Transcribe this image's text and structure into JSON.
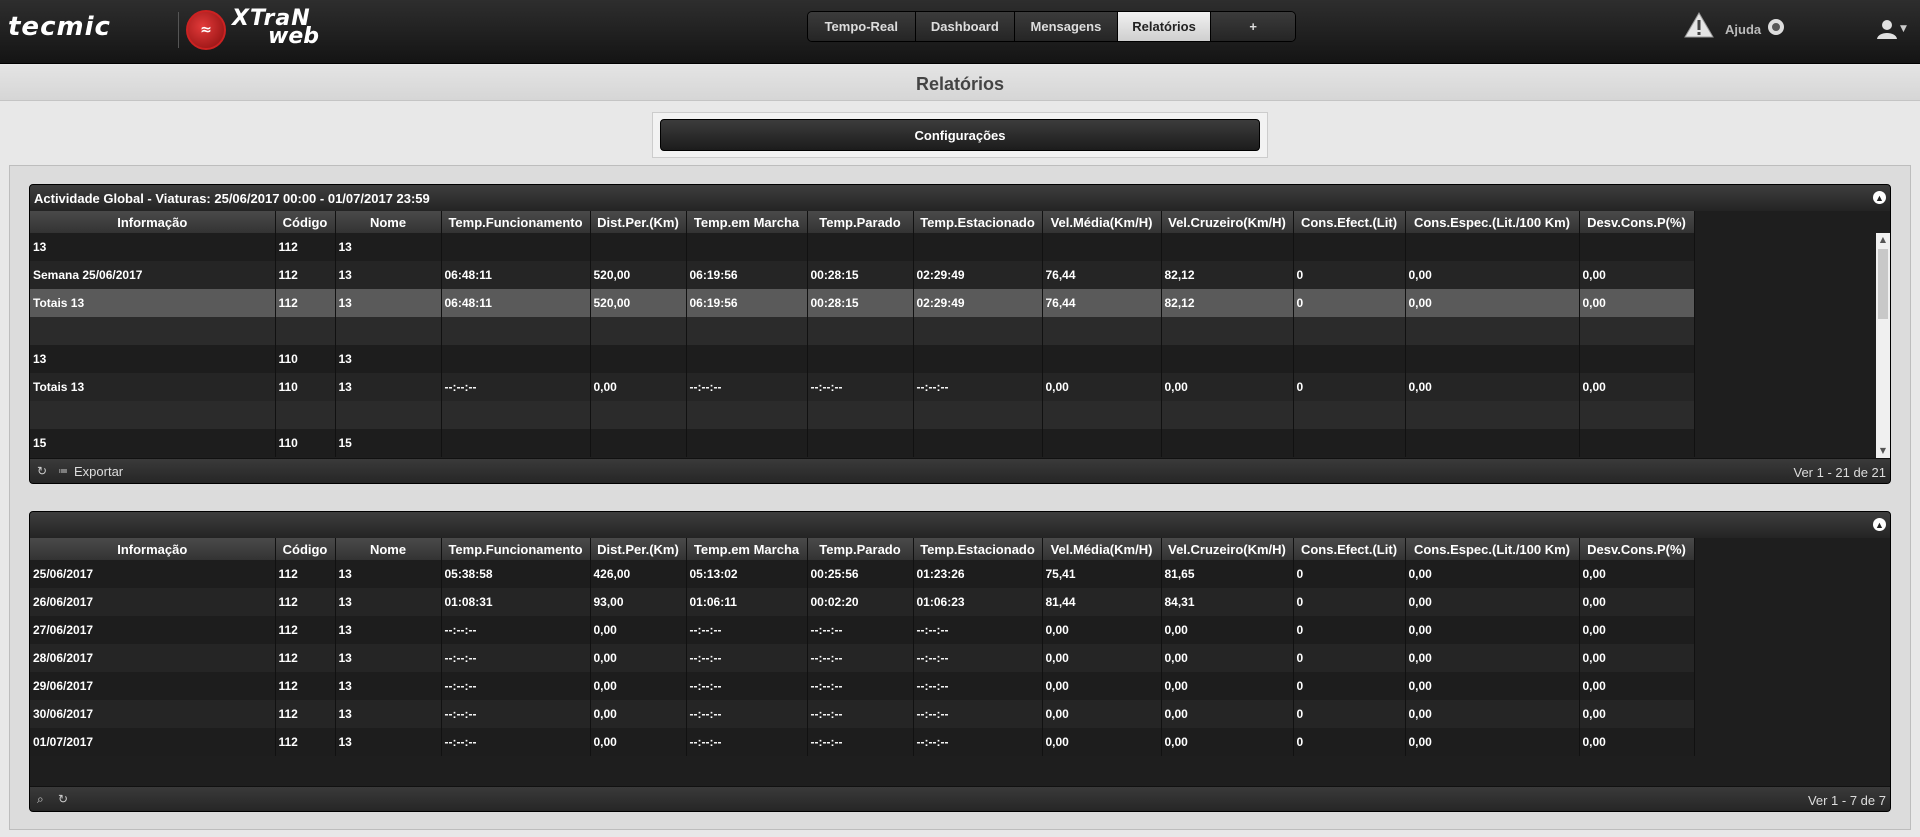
{
  "brand": {
    "tecmic": "tecmic",
    "xtran_l1": "XTraN",
    "xtran_l2": "web"
  },
  "nav": [
    {
      "label": "Tempo-Real"
    },
    {
      "label": "Dashboard"
    },
    {
      "label": "Mensagens"
    },
    {
      "label": "Relatórios"
    },
    {
      "label": "+"
    }
  ],
  "nav_active": "Relatórios",
  "header_right": {
    "help": "Ajuda"
  },
  "page": {
    "title": "Relatórios",
    "config_label": "Configurações"
  },
  "columns": [
    "Informação",
    "Código",
    "Nome",
    "Temp.Funcionamento",
    "Dist.Per.(Km)",
    "Temp.em Marcha",
    "Temp.Parado",
    "Temp.Estacionado",
    "Vel.Média(Km/H)",
    "Vel.Cruzeiro(Km/H)",
    "Cons.Efect.(Lit)",
    "Cons.Espec.(Lit./100 Km)",
    "Desv.Cons.P(%)"
  ],
  "panel1": {
    "title": "Actividade Global - Viaturas: 25/06/2017 00:00 - 01/07/2017 23:59",
    "rows": [
      {
        "style": "odd",
        "cells": [
          "13",
          "112",
          "13",
          "",
          "",
          "",
          "",
          "",
          "",
          "",
          "",
          "",
          ""
        ]
      },
      {
        "style": "even",
        "cells": [
          "Semana 25/06/2017",
          "112",
          "13",
          "06:48:11",
          "520,00",
          "06:19:56",
          "00:28:15",
          "02:29:49",
          "76,44",
          "82,12",
          "0",
          "0,00",
          "0,00"
        ]
      },
      {
        "style": "highlight",
        "cells": [
          "Totais 13",
          "112",
          "13",
          "06:48:11",
          "520,00",
          "06:19:56",
          "00:28:15",
          "02:29:49",
          "76,44",
          "82,12",
          "0",
          "0,00",
          "0,00"
        ]
      },
      {
        "style": "blank",
        "cells": [
          "",
          "",
          "",
          "",
          "",
          "",
          "",
          "",
          "",
          "",
          "",
          "",
          ""
        ]
      },
      {
        "style": "odd",
        "cells": [
          "13",
          "110",
          "13",
          "",
          "",
          "",
          "",
          "",
          "",
          "",
          "",
          "",
          ""
        ]
      },
      {
        "style": "even",
        "cells": [
          "Totais 13",
          "110",
          "13",
          "--:--:--",
          "0,00",
          "--:--:--",
          "--:--:--",
          "--:--:--",
          "0,00",
          "0,00",
          "0",
          "0,00",
          "0,00"
        ]
      },
      {
        "style": "blank",
        "cells": [
          "",
          "",
          "",
          "",
          "",
          "",
          "",
          "",
          "",
          "",
          "",
          "",
          ""
        ]
      },
      {
        "style": "odd",
        "cells": [
          "15",
          "110",
          "15",
          "",
          "",
          "",
          "",
          "",
          "",
          "",
          "",
          "",
          ""
        ]
      }
    ],
    "export_label": "Exportar",
    "count": "Ver 1 - 21 de 21"
  },
  "panel2": {
    "rows": [
      {
        "style": "odd",
        "cells": [
          "25/06/2017",
          "112",
          "13",
          "05:38:58",
          "426,00",
          "05:13:02",
          "00:25:56",
          "01:23:26",
          "75,41",
          "81,65",
          "0",
          "0,00",
          "0,00"
        ]
      },
      {
        "style": "even",
        "cells": [
          "26/06/2017",
          "112",
          "13",
          "01:08:31",
          "93,00",
          "01:06:11",
          "00:02:20",
          "01:06:23",
          "81,44",
          "84,31",
          "0",
          "0,00",
          "0,00"
        ]
      },
      {
        "style": "odd",
        "cells": [
          "27/06/2017",
          "112",
          "13",
          "--:--:--",
          "0,00",
          "--:--:--",
          "--:--:--",
          "--:--:--",
          "0,00",
          "0,00",
          "0",
          "0,00",
          "0,00"
        ]
      },
      {
        "style": "even",
        "cells": [
          "28/06/2017",
          "112",
          "13",
          "--:--:--",
          "0,00",
          "--:--:--",
          "--:--:--",
          "--:--:--",
          "0,00",
          "0,00",
          "0",
          "0,00",
          "0,00"
        ]
      },
      {
        "style": "odd",
        "cells": [
          "29/06/2017",
          "112",
          "13",
          "--:--:--",
          "0,00",
          "--:--:--",
          "--:--:--",
          "--:--:--",
          "0,00",
          "0,00",
          "0",
          "0,00",
          "0,00"
        ]
      },
      {
        "style": "even",
        "cells": [
          "30/06/2017",
          "112",
          "13",
          "--:--:--",
          "0,00",
          "--:--:--",
          "--:--:--",
          "--:--:--",
          "0,00",
          "0,00",
          "0",
          "0,00",
          "0,00"
        ]
      },
      {
        "style": "odd",
        "cells": [
          "01/07/2017",
          "112",
          "13",
          "--:--:--",
          "0,00",
          "--:--:--",
          "--:--:--",
          "--:--:--",
          "0,00",
          "0,00",
          "0",
          "0,00",
          "0,00"
        ]
      }
    ],
    "count": "Ver 1 - 7 de 7"
  },
  "icons": {
    "warning": "warning-icon",
    "help": "lifebuoy-icon",
    "user": "user-icon",
    "refresh": "refresh-icon",
    "search": "search-icon",
    "collapse": "collapse-icon"
  }
}
